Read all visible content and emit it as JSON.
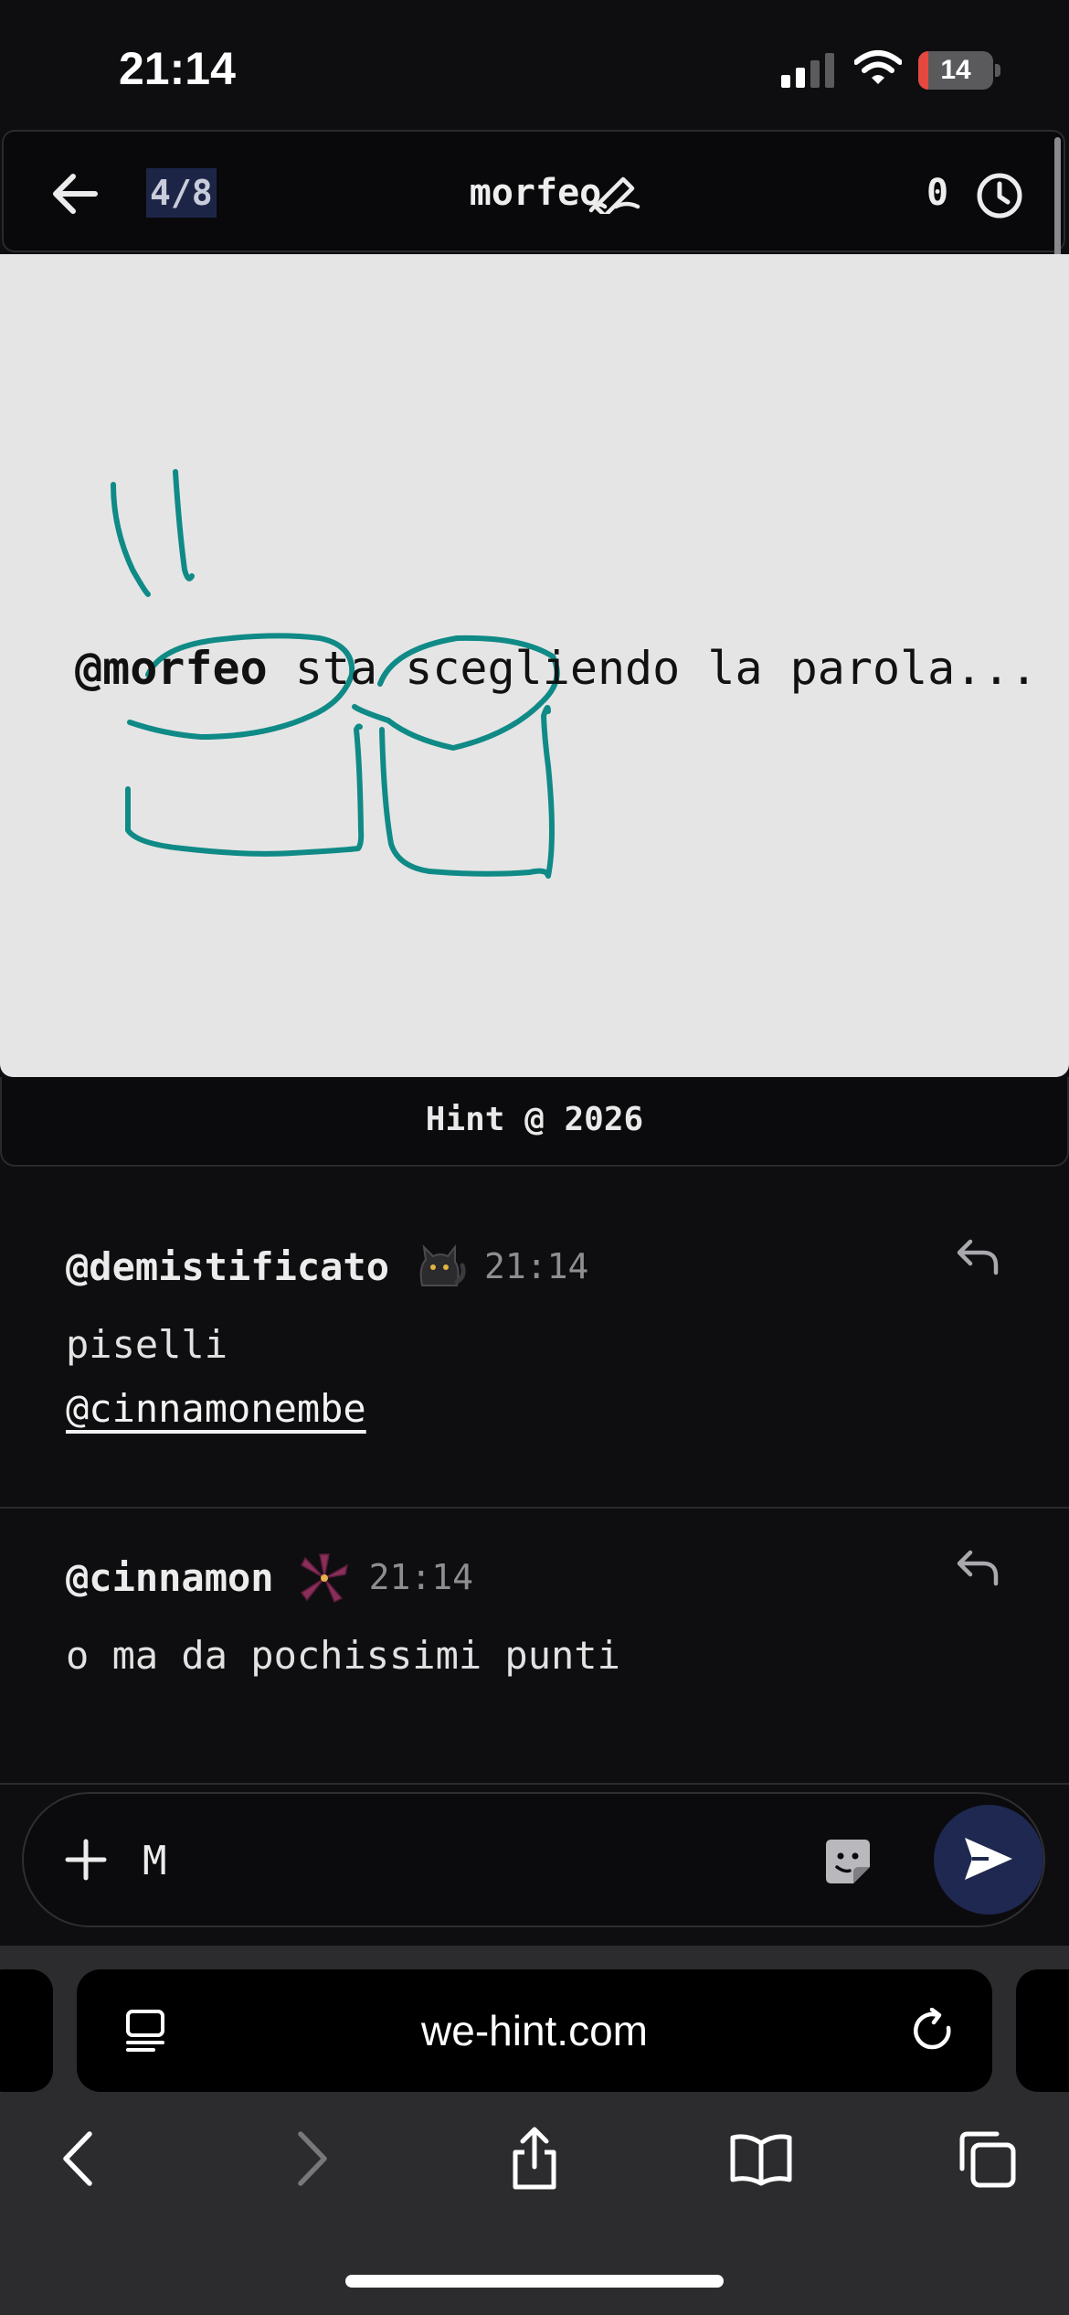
{
  "status_bar": {
    "time": "21:14",
    "battery": "14",
    "battery_level": 0.14
  },
  "header": {
    "round": "4/8",
    "drawer": "morfeo",
    "timer": "0"
  },
  "canvas": {
    "status_user": "@morfeo",
    "status_text": " sta scegliendo la parola..."
  },
  "footer": {
    "text": "Hint @ 2026"
  },
  "messages": [
    {
      "user": "@demistificato",
      "emoji_icon": "black-cat-icon",
      "time": "21:14",
      "text": "piselli",
      "mention": "@cinnamonembe"
    },
    {
      "user": "@cinnamon",
      "emoji_icon": "lily-flower-icon",
      "time": "21:14",
      "text": "o ma da pochissimi punti"
    }
  ],
  "input": {
    "value": "M"
  },
  "browser": {
    "url": "we-hint.com"
  },
  "colors": {
    "stroke": "#0f8a86",
    "send": "#1e2850",
    "round_highlight": "#1d2547",
    "battery_low": "#e5483f"
  }
}
